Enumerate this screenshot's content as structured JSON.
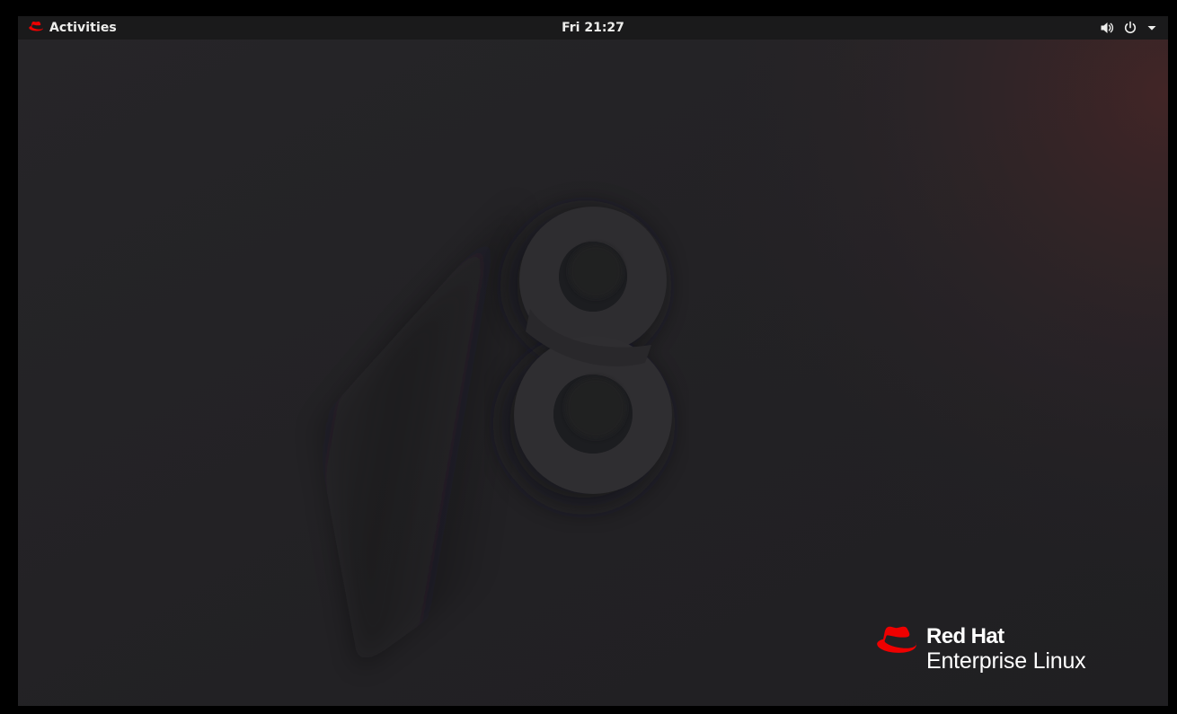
{
  "topbar": {
    "activities_label": "Activities",
    "clock": "Fri 21:27",
    "icons": {
      "activities": "redhat-logo-icon",
      "volume": "volume-icon",
      "power": "power-icon",
      "menu": "chevron-down-icon"
    }
  },
  "wallpaper": {
    "version_mark": "8",
    "brand": {
      "name": "Red Hat",
      "product": "Enterprise Linux"
    }
  },
  "colors": {
    "topbar_bg": "#1a1a1b",
    "desktop_bg": "#242326",
    "brand_red": "#ee0000",
    "text": "#eeeeec"
  }
}
